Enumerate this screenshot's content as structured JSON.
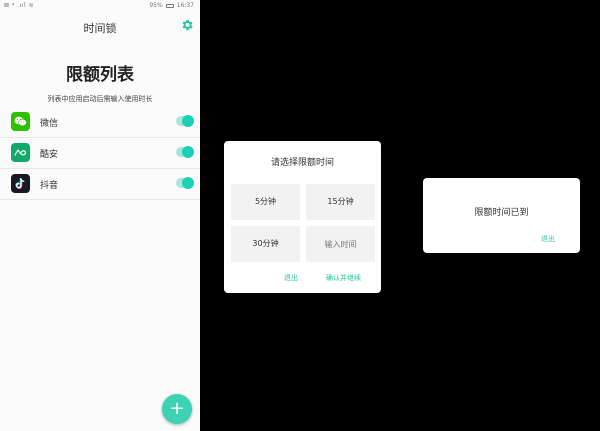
{
  "statusbar": {
    "left": "⊠ ᵍ .ııl ≋",
    "battery": "95%",
    "time": "16:37"
  },
  "screen1": {
    "title": "时间锁",
    "heading": "限额列表",
    "subtitle": "列表中应用启动后需输入使用时长",
    "apps": [
      {
        "name": "微信",
        "icon": "wechat-icon",
        "color": "#2dc100",
        "enabled": true
      },
      {
        "name": "酷安",
        "icon": "coolapk-icon",
        "color": "#11a869",
        "enabled": true
      },
      {
        "name": "抖音",
        "icon": "douyin-icon",
        "color": "#161823",
        "enabled": true
      }
    ],
    "fab_label": "+"
  },
  "dialog_limit": {
    "title": "请选择限额时间",
    "options": [
      "5分钟",
      "15分钟",
      "30分钟"
    ],
    "input_placeholder": "输入时间",
    "exit_label": "退出",
    "confirm_label": "确认并继续"
  },
  "dialog_reached": {
    "message": "限额时间已到",
    "exit_label": "退出"
  },
  "colors": {
    "accent": "#2ec3a2",
    "fab": "#3ed1b2"
  }
}
